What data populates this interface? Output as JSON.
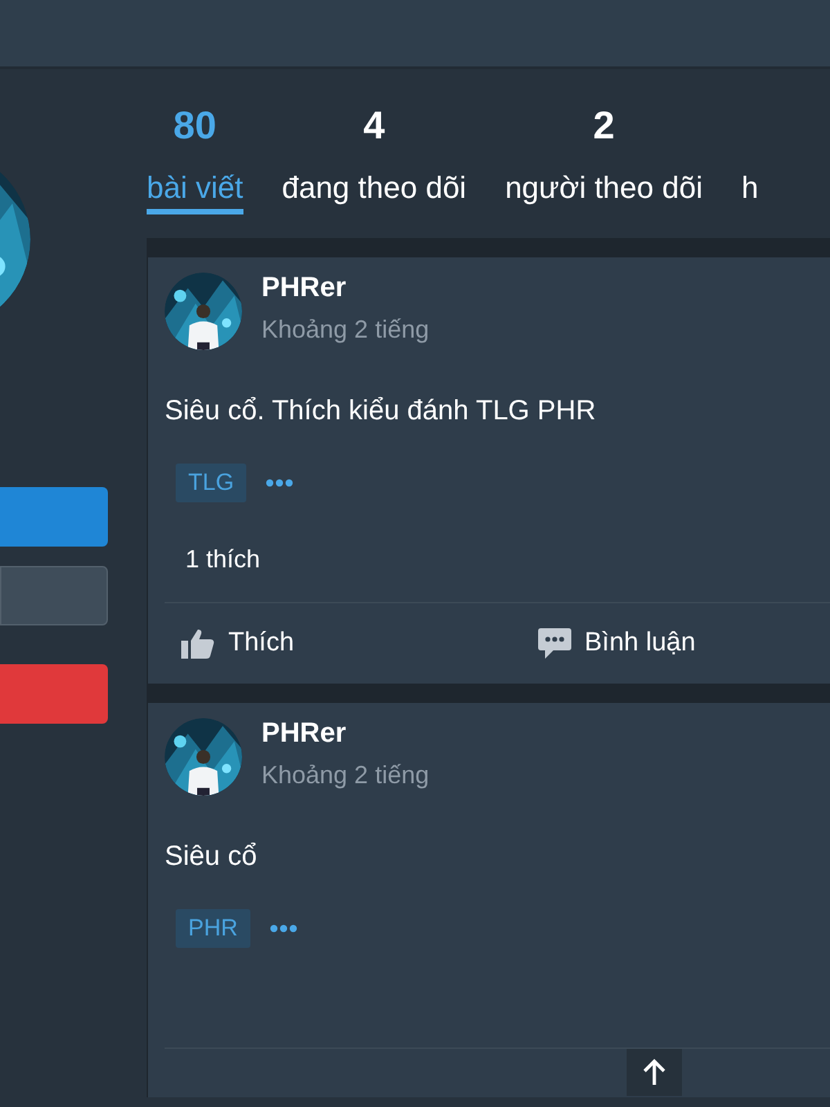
{
  "sidebar": {
    "buttons": [
      {
        "kind": "primary"
      },
      {
        "kind": "secondary"
      },
      {
        "kind": "danger"
      }
    ]
  },
  "stats": [
    {
      "count": "80",
      "label": "bài viết",
      "selected": true
    },
    {
      "count": "4",
      "label": "đang theo dõi",
      "selected": false
    },
    {
      "count": "2",
      "label": "người theo dõi",
      "selected": false
    },
    {
      "label": "h",
      "selected": false
    }
  ],
  "posts": [
    {
      "author": "PHRer",
      "time": "Khoảng 2 tiếng",
      "text": "Siêu cổ. Thích kiểu đánh TLG PHR",
      "tags": [
        "TLG"
      ],
      "likes": "1 thích",
      "actions": [
        {
          "kind": "like",
          "label": "Thích"
        },
        {
          "kind": "comment",
          "label": "Bình luận"
        }
      ]
    },
    {
      "author": "PHRer",
      "time": "Khoảng 2 tiếng",
      "text": "Siêu cổ",
      "tags": [
        "PHR"
      ]
    }
  ]
}
